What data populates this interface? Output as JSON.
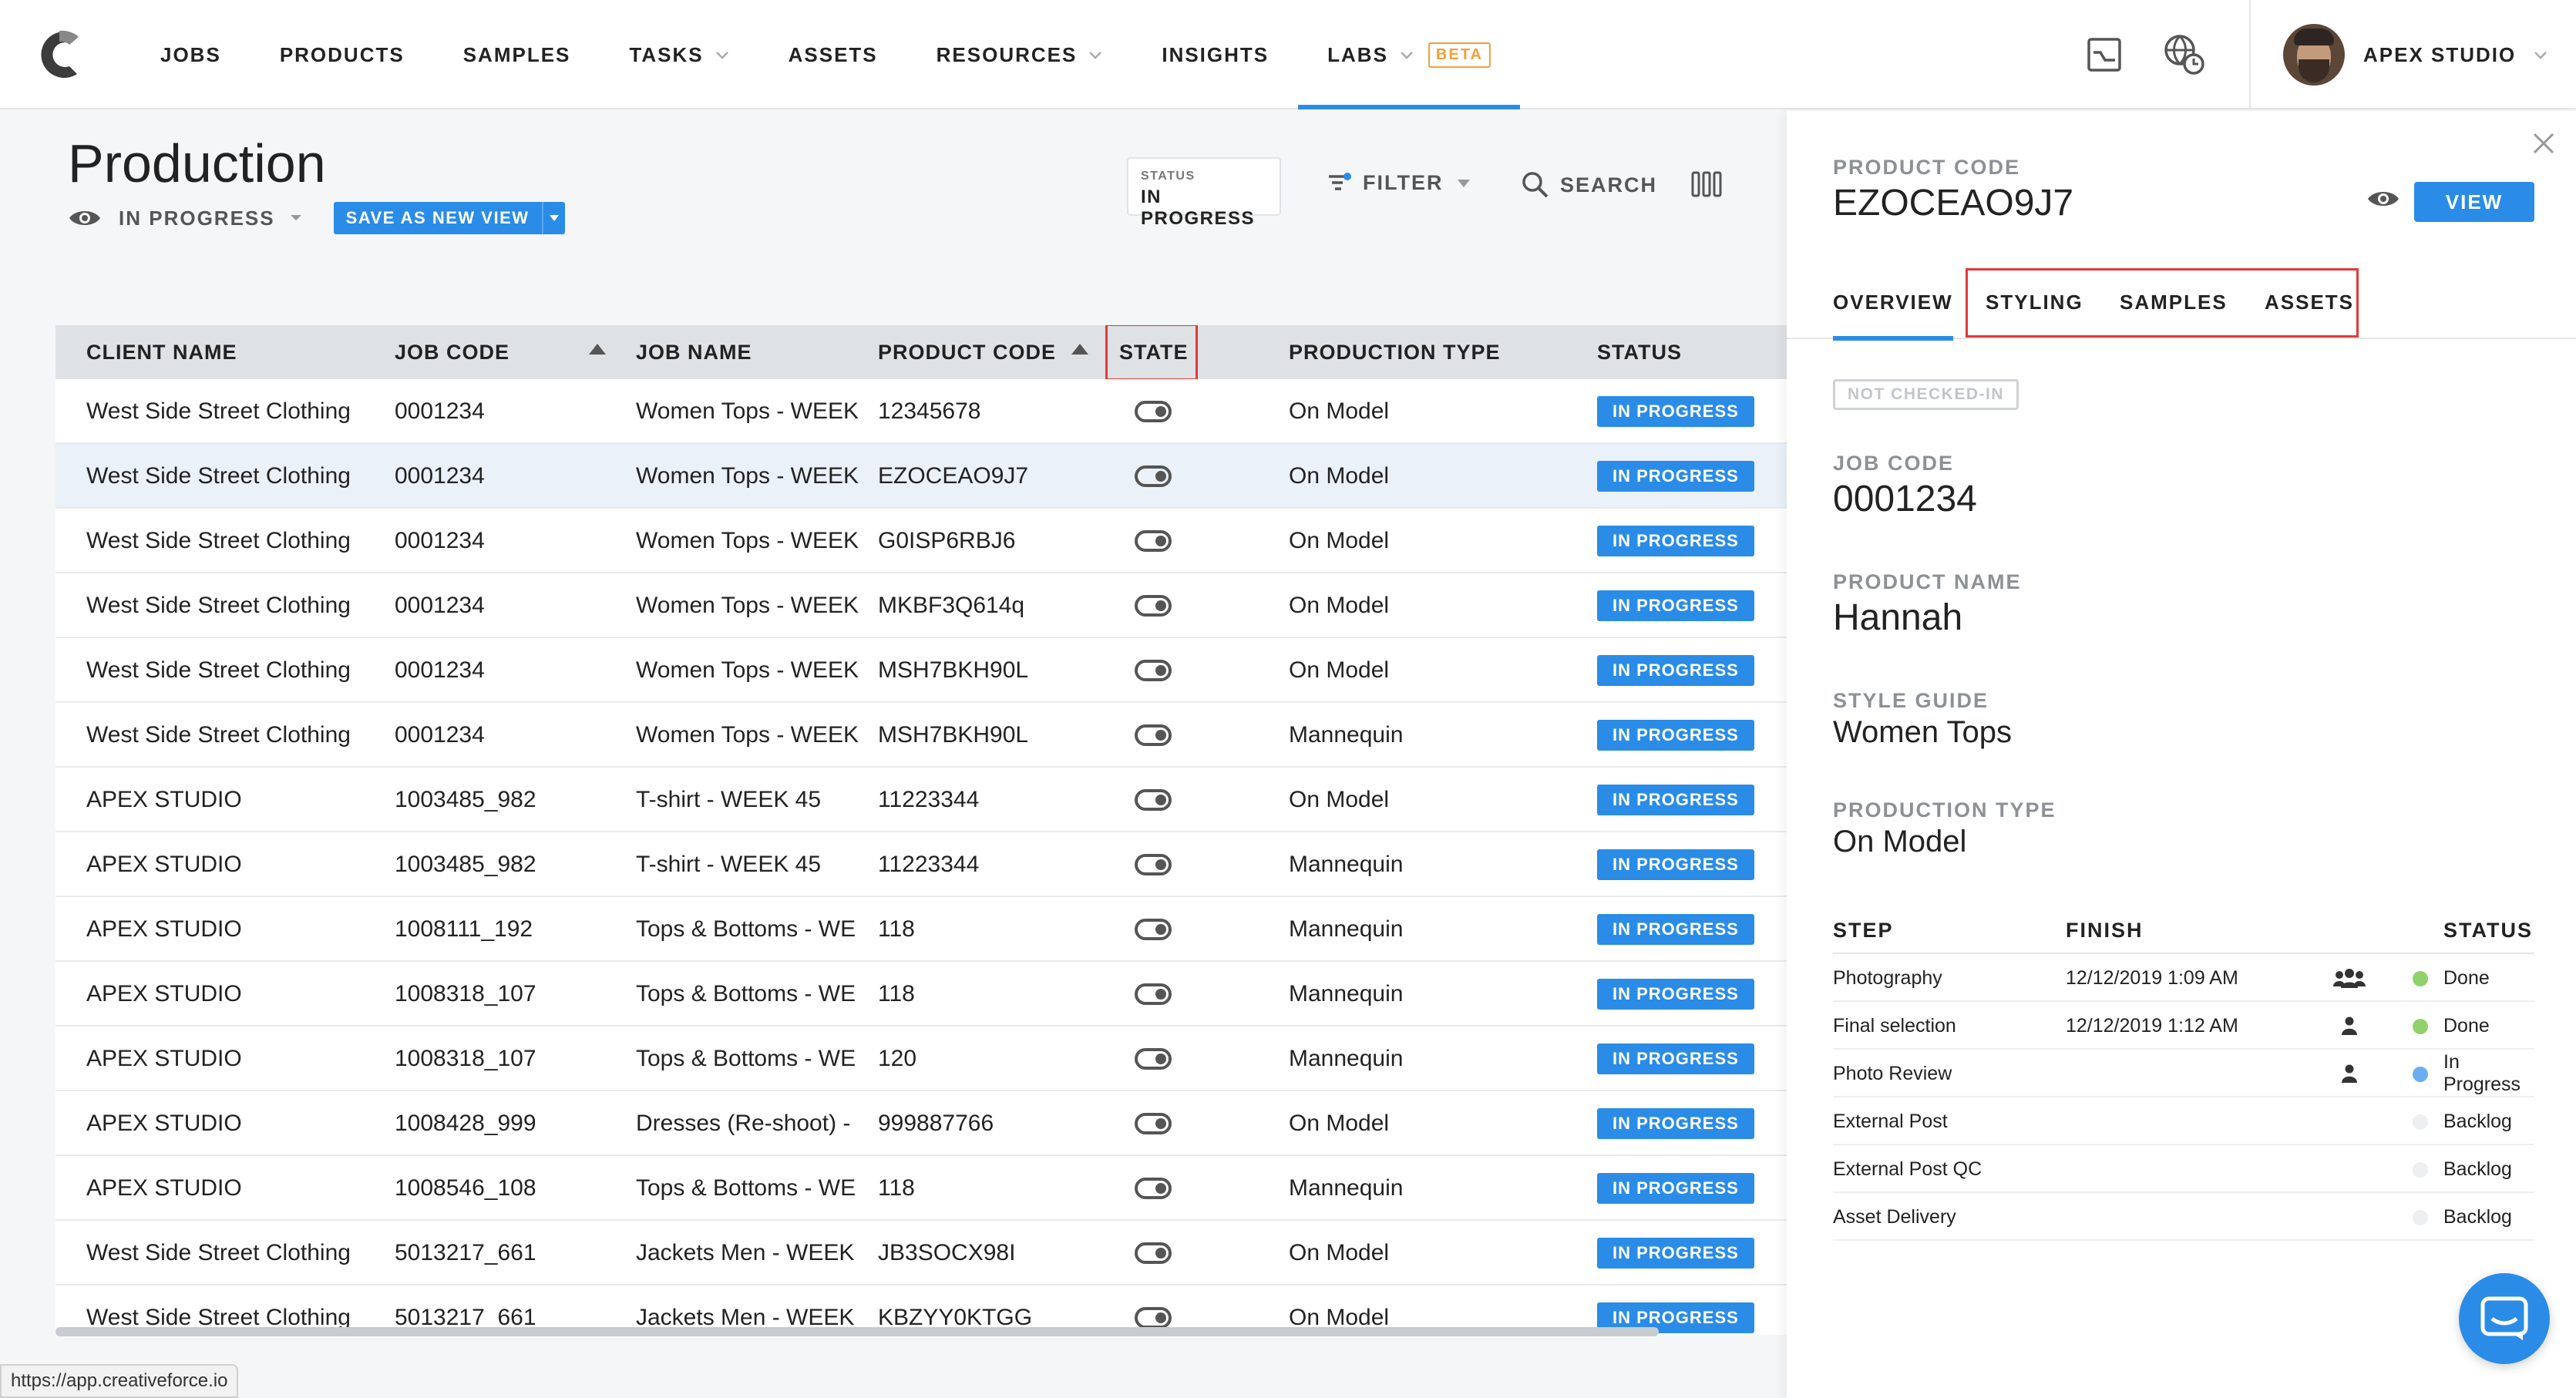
{
  "nav": {
    "items": [
      {
        "label": "JOBS",
        "dropdown": false
      },
      {
        "label": "PRODUCTS",
        "dropdown": false
      },
      {
        "label": "SAMPLES",
        "dropdown": false
      },
      {
        "label": "TASKS",
        "dropdown": true
      },
      {
        "label": "ASSETS",
        "dropdown": false
      },
      {
        "label": "RESOURCES",
        "dropdown": true
      },
      {
        "label": "INSIGHTS",
        "dropdown": false
      },
      {
        "label": "LABS",
        "dropdown": true,
        "active": true
      }
    ],
    "beta_badge": "BETA",
    "icons": [
      "reports-icon",
      "world-clock-icon"
    ],
    "user_name": "APEX STUDIO"
  },
  "main": {
    "title": "Production",
    "view_label": "IN PROGRESS",
    "save_view_button": "SAVE AS NEW VIEW",
    "status_box": {
      "label": "STATUS",
      "value": "IN PROGRESS"
    },
    "filter_label": "FILTER",
    "search_label": "SEARCH"
  },
  "table": {
    "columns": [
      "CLIENT NAME",
      "JOB CODE",
      "JOB NAME",
      "PRODUCT CODE",
      "STATE",
      "PRODUCTION TYPE",
      "STATUS"
    ],
    "sorted_columns": [
      "JOB CODE",
      "PRODUCT CODE"
    ],
    "highlighted_column": "STATE",
    "rows": [
      {
        "client": "West Side Street Clothing",
        "job_code": "0001234",
        "job_name": "Women Tops - WEEK",
        "product_code": "12345678",
        "production_type": "On Model",
        "status": "IN PROGRESS"
      },
      {
        "client": "West Side Street Clothing",
        "job_code": "0001234",
        "job_name": "Women Tops - WEEK",
        "product_code": "EZOCEAO9J7",
        "production_type": "On Model",
        "status": "IN PROGRESS",
        "selected": true
      },
      {
        "client": "West Side Street Clothing",
        "job_code": "0001234",
        "job_name": "Women Tops - WEEK",
        "product_code": "G0ISP6RBJ6",
        "production_type": "On Model",
        "status": "IN PROGRESS"
      },
      {
        "client": "West Side Street Clothing",
        "job_code": "0001234",
        "job_name": "Women Tops - WEEK",
        "product_code": "MKBF3Q614q",
        "production_type": "On Model",
        "status": "IN PROGRESS"
      },
      {
        "client": "West Side Street Clothing",
        "job_code": "0001234",
        "job_name": "Women Tops - WEEK",
        "product_code": "MSH7BKH90L",
        "production_type": "On Model",
        "status": "IN PROGRESS"
      },
      {
        "client": "West Side Street Clothing",
        "job_code": "0001234",
        "job_name": "Women Tops - WEEK",
        "product_code": "MSH7BKH90L",
        "production_type": "Mannequin",
        "status": "IN PROGRESS"
      },
      {
        "client": "APEX STUDIO",
        "job_code": "1003485_982",
        "job_name": "T-shirt - WEEK 45",
        "product_code": "11223344",
        "production_type": "On Model",
        "status": "IN PROGRESS"
      },
      {
        "client": "APEX STUDIO",
        "job_code": "1003485_982",
        "job_name": "T-shirt - WEEK 45",
        "product_code": "11223344",
        "production_type": "Mannequin",
        "status": "IN PROGRESS"
      },
      {
        "client": "APEX STUDIO",
        "job_code": "1008111_192",
        "job_name": "Tops & Bottoms - WE",
        "product_code": "118",
        "production_type": "Mannequin",
        "status": "IN PROGRESS"
      },
      {
        "client": "APEX STUDIO",
        "job_code": "1008318_107",
        "job_name": "Tops & Bottoms - WE",
        "product_code": "118",
        "production_type": "Mannequin",
        "status": "IN PROGRESS"
      },
      {
        "client": "APEX STUDIO",
        "job_code": "1008318_107",
        "job_name": "Tops & Bottoms - WE",
        "product_code": "120",
        "production_type": "Mannequin",
        "status": "IN PROGRESS"
      },
      {
        "client": "APEX STUDIO",
        "job_code": "1008428_999",
        "job_name": "Dresses (Re-shoot) -",
        "product_code": "999887766",
        "production_type": "On Model",
        "status": "IN PROGRESS"
      },
      {
        "client": "APEX STUDIO",
        "job_code": "1008546_108",
        "job_name": "Tops & Bottoms - WE",
        "product_code": "118",
        "production_type": "Mannequin",
        "status": "IN PROGRESS"
      },
      {
        "client": "West Side Street Clothing",
        "job_code": "5013217_661",
        "job_name": "Jackets Men - WEEK",
        "product_code": "JB3SOCX98I",
        "production_type": "On Model",
        "status": "IN PROGRESS"
      },
      {
        "client": "West Side Street Clothing",
        "job_code": "5013217_661",
        "job_name": "Jackets Men - WEEK",
        "product_code": "KBZYY0KTGG",
        "production_type": "On Model",
        "status": "IN PROGRESS"
      }
    ]
  },
  "panel": {
    "product_code_label": "PRODUCT CODE",
    "product_code": "EZOCEAO9J7",
    "view_button": "VIEW",
    "tabs": [
      "OVERVIEW",
      "STYLING",
      "SAMPLES",
      "ASSETS"
    ],
    "active_tab": "OVERVIEW",
    "highlighted_tabs": [
      "STYLING",
      "SAMPLES",
      "ASSETS"
    ],
    "checkin_badge": "NOT CHECKED-IN",
    "job_code_label": "JOB CODE",
    "job_code": "0001234",
    "product_name_label": "PRODUCT NAME",
    "product_name": "Hannah",
    "style_guide_label": "STYLE GUIDE",
    "style_guide": "Women Tops",
    "production_type_label": "PRODUCTION TYPE",
    "production_type": "On Model",
    "steps_header": {
      "step": "STEP",
      "finish": "FINISH",
      "status": "STATUS"
    },
    "steps": [
      {
        "step": "Photography",
        "finish": "12/12/2019 1:09 AM",
        "assignee": "group-icon",
        "status": "Done",
        "status_color": "#8fd16a"
      },
      {
        "step": "Final selection",
        "finish": "12/12/2019 1:12 AM",
        "assignee": "person-icon",
        "status": "Done",
        "status_color": "#8fd16a"
      },
      {
        "step": "Photo Review",
        "finish": "",
        "assignee": "person-icon",
        "status": "In Progress",
        "status_color": "#6aaef0"
      },
      {
        "step": "External Post",
        "finish": "",
        "assignee": "",
        "status": "Backlog",
        "status_color": "#eeeff0"
      },
      {
        "step": "External Post QC",
        "finish": "",
        "assignee": "",
        "status": "Backlog",
        "status_color": "#eeeff0"
      },
      {
        "step": "Asset Delivery",
        "finish": "",
        "assignee": "",
        "status": "Backlog",
        "status_color": "#eeeff0"
      }
    ]
  },
  "status_url": "https://app.creativeforce.io",
  "colors": {
    "accent": "#2a8ce6",
    "highlight": "#e2383a",
    "beta": "#f0a03c"
  }
}
